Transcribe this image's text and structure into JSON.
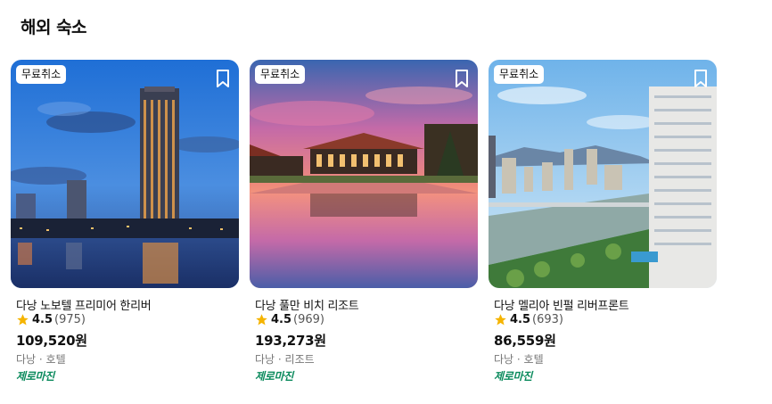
{
  "section": {
    "title": "해외 숙소"
  },
  "cards": [
    {
      "badge": "무료취소",
      "name": "다낭 노보텔 프리미어 한리버",
      "rating": "4.5",
      "reviews": "(975)",
      "price": "109,520원",
      "meta": "다낭 · 호텔",
      "tag": "제로마진",
      "image_icon": "hotel-tower-night-photo"
    },
    {
      "badge": "무료취소",
      "name": "다낭 풀만 비치 리조트",
      "rating": "4.5",
      "reviews": "(969)",
      "price": "193,273원",
      "meta": "다낭 · 리조트",
      "tag": "제로마진",
      "image_icon": "resort-pool-sunset-photo"
    },
    {
      "badge": "무료취소",
      "name": "다낭 멜리아 빈펄 리버프론트",
      "rating": "4.5",
      "reviews": "(693)",
      "price": "86,559원",
      "meta": "다낭 · 호텔",
      "tag": "제로마진",
      "image_icon": "riverfront-city-photo"
    }
  ],
  "colors": {
    "star": "#f5b400",
    "tag": "#0a8a5c",
    "meta": "#777777"
  }
}
